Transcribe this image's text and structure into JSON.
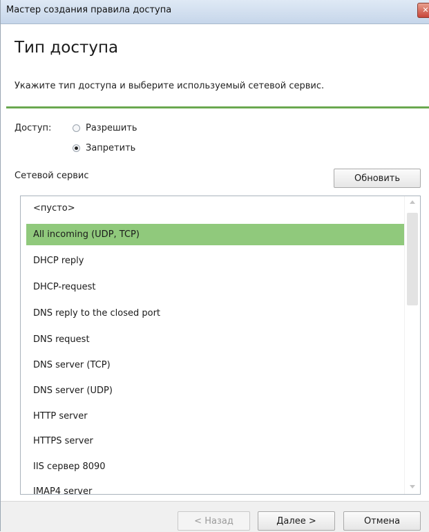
{
  "window": {
    "title": "Мастер создания правила доступа",
    "close_glyph": "✕"
  },
  "header": {
    "heading": "Тип доступа",
    "subtitle": "Укажите тип доступа и выберите используемый сетевой сервис."
  },
  "access": {
    "label": "Доступ:",
    "options": [
      {
        "label": "Разрешить",
        "checked": false
      },
      {
        "label": "Запретить",
        "checked": true
      }
    ]
  },
  "service": {
    "label": "Сетевой сервис",
    "refresh_label": "Обновить",
    "items": [
      "<пусто>",
      "All incoming (UDP, TCP)",
      "DHCP reply",
      "DHCP-request",
      "DNS reply to the closed port",
      "DNS request",
      "DNS server (TCP)",
      "DNS server (UDP)",
      "HTTP server",
      "HTTPS server",
      "IIS сервер 8090",
      "IMAP4 server"
    ],
    "selected_index": 1
  },
  "footer": {
    "back_label": "< Назад",
    "next_label": "Далее >",
    "cancel_label": "Отмена"
  },
  "colors": {
    "accent_green": "#6aa84f",
    "selected_row": "#90c97c"
  }
}
